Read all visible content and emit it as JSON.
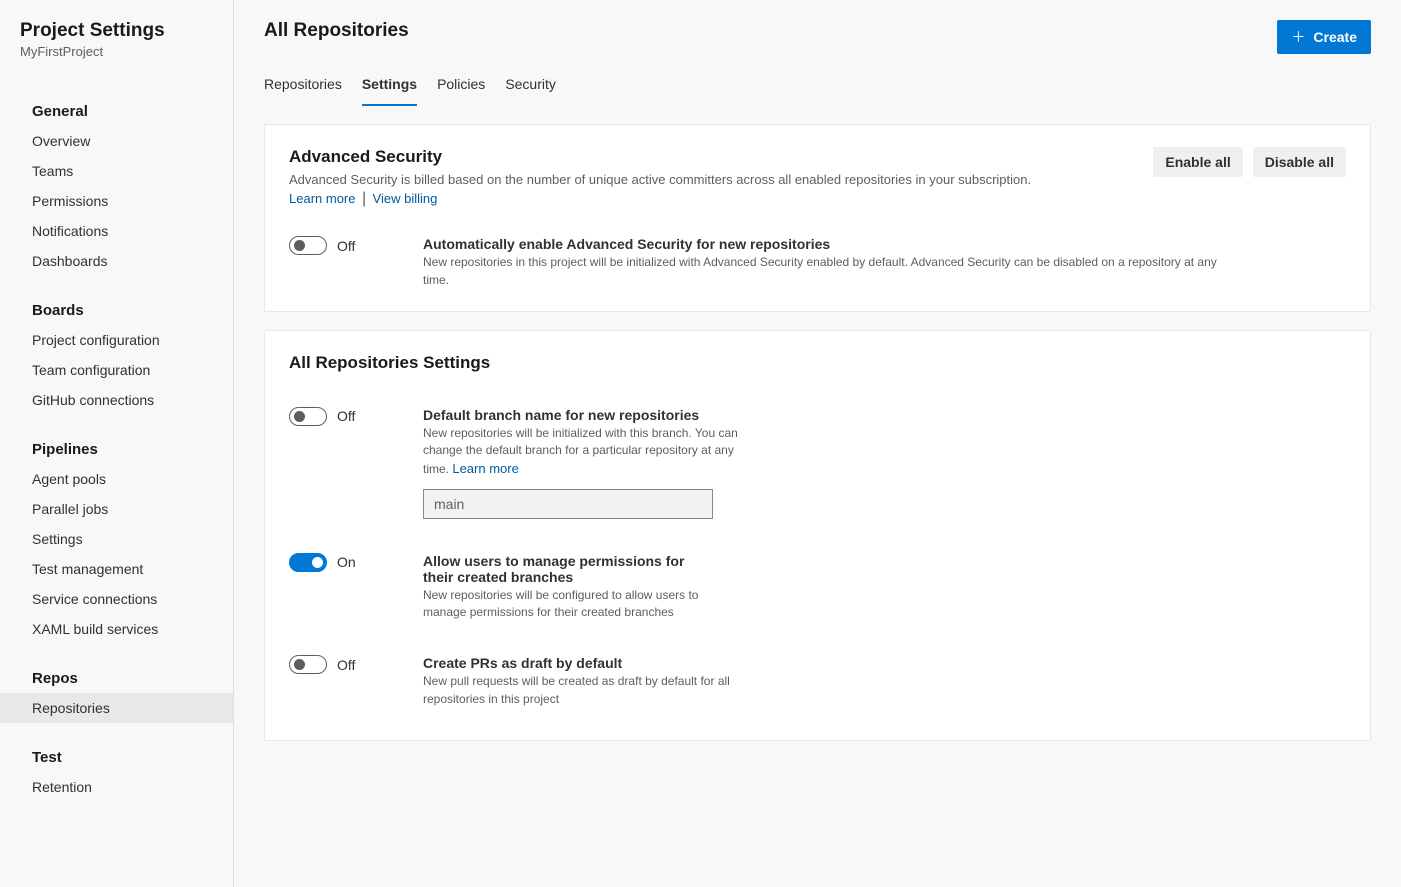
{
  "sidebar": {
    "title": "Project Settings",
    "subtitle": "MyFirstProject",
    "sections": [
      {
        "title": "General",
        "items": [
          "Overview",
          "Teams",
          "Permissions",
          "Notifications",
          "Dashboards"
        ]
      },
      {
        "title": "Boards",
        "items": [
          "Project configuration",
          "Team configuration",
          "GitHub connections"
        ]
      },
      {
        "title": "Pipelines",
        "items": [
          "Agent pools",
          "Parallel jobs",
          "Settings",
          "Test management",
          "Service connections",
          "XAML build services"
        ]
      },
      {
        "title": "Repos",
        "items": [
          "Repositories"
        ]
      },
      {
        "title": "Test",
        "items": [
          "Retention"
        ]
      }
    ],
    "active": "Repositories"
  },
  "header": {
    "title": "All Repositories",
    "createLabel": "Create"
  },
  "tabs": [
    "Repositories",
    "Settings",
    "Policies",
    "Security"
  ],
  "activeTab": "Settings",
  "advSec": {
    "title": "Advanced Security",
    "desc": "Advanced Security is billed based on the number of unique active committers across all enabled repositories in your subscription.",
    "learnMore": "Learn more",
    "viewBilling": "View billing",
    "enableAll": "Enable all",
    "disableAll": "Disable all",
    "toggle": {
      "state": "Off",
      "on": false,
      "title": "Automatically enable Advanced Security for new repositories",
      "desc": "New repositories in this project will be initialized with Advanced Security enabled by default. Advanced Security can be disabled on a repository at any time."
    }
  },
  "repoSettings": {
    "title": "All Repositories Settings",
    "rows": [
      {
        "state": "Off",
        "on": false,
        "title": "Default branch name for new repositories",
        "desc": "New repositories will be initialized with this branch. You can change the default branch for a particular repository at any time. ",
        "link": "Learn more",
        "placeholder": "main"
      },
      {
        "state": "On",
        "on": true,
        "title": "Allow users to manage permissions for their created branches",
        "desc": "New repositories will be configured to allow users to manage permissions for their created branches"
      },
      {
        "state": "Off",
        "on": false,
        "title": "Create PRs as draft by default",
        "desc": "New pull requests will be created as draft by default for all repositories in this project"
      }
    ]
  }
}
